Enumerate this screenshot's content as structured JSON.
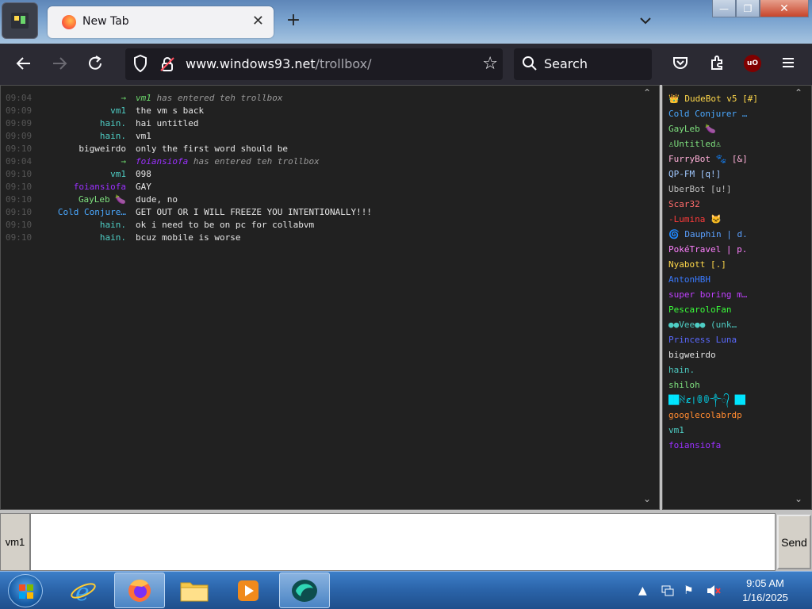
{
  "browser": {
    "tab_title": "New Tab",
    "tab_close": "✕",
    "new_tab": "+",
    "tab_list": "⌄",
    "url_host": "www.windows93.net",
    "url_path": "/trollbox/",
    "search_placeholder": "Search",
    "ublock_label": "uO",
    "window_min": "—",
    "window_max": "❐",
    "window_close": "✕"
  },
  "chat": {
    "messages": [
      {
        "time": "09:04",
        "nick": "→",
        "nick_color": "#6bd66b",
        "text_nick": "vm1",
        "text_nick_color": "#6bd66b",
        "text": "has entered teh trollbox",
        "system": true
      },
      {
        "time": "09:09",
        "nick": "vm1",
        "nick_color": "#4ecdc4",
        "text": "the vm s back",
        "system": false
      },
      {
        "time": "09:09",
        "nick": "hain.",
        "nick_color": "#4ecdc4",
        "text": "hai untitled",
        "system": false
      },
      {
        "time": "09:09",
        "nick": "hain.",
        "nick_color": "#4ecdc4",
        "text": "vm1",
        "system": false
      },
      {
        "time": "09:10",
        "nick": "bigweirdo",
        "nick_color": "#e6e6e6",
        "text": "only the first word should be",
        "system": false
      },
      {
        "time": "09:04",
        "nick": "→",
        "nick_color": "#6bd66b",
        "text_nick": "foiansiofa",
        "text_nick_color": "#9b30ff",
        "text": "has entered teh trollbox",
        "system": true
      },
      {
        "time": "09:10",
        "nick": "vm1",
        "nick_color": "#4ecdc4",
        "text": "098",
        "system": false
      },
      {
        "time": "09:10",
        "nick": "foiansiofa",
        "nick_color": "#9b30ff",
        "text": "GAY",
        "system": false
      },
      {
        "time": "09:10",
        "nick": "GayLeb 🍆",
        "nick_color": "#7ee07e",
        "text": "dude, no",
        "system": false
      },
      {
        "time": "09:10",
        "nick": "Cold Conjure…",
        "nick_color": "#4aa8ff",
        "text": "GET OUT OR I WILL FREEZE YOU INTENTIONALLY!!!",
        "system": false
      },
      {
        "time": "09:10",
        "nick": "hain.",
        "nick_color": "#4ecdc4",
        "text": "ok i need to be on pc for collabvm",
        "system": false
      },
      {
        "time": "09:10",
        "nick": "hain.",
        "nick_color": "#4ecdc4",
        "text": "bcuz mobile is worse",
        "system": false
      }
    ],
    "current_nick": "vm1",
    "send_label": "Send",
    "input_value": ""
  },
  "users": [
    {
      "name": "👑 DudeBot v5 [#]",
      "color": "#ffd84a"
    },
    {
      "name": "Cold Conjurer …",
      "color": "#4aa8ff"
    },
    {
      "name": "GayLeb 🍆",
      "color": "#7ee07e"
    },
    {
      "name": "♙Untitled♙",
      "color": "#7ee07e"
    },
    {
      "name": "FurryBot 🐾 [&]",
      "color": "#ffb0d8"
    },
    {
      "name": "QP-FM [q!]",
      "color": "#a0c8ff"
    },
    {
      "name": "UberBot [u!]",
      "color": "#bbbbbb"
    },
    {
      "name": "Scar32",
      "color": "#ff6b6b"
    },
    {
      "name": "-Lumina 🐱",
      "color": "#ff3b3b"
    },
    {
      "name": "🌀 Dauphin | d.",
      "color": "#5aa0ff"
    },
    {
      "name": "PokéTravel | p.",
      "color": "#ff80ff"
    },
    {
      "name": "Nyabott [.]",
      "color": "#ffd84a"
    },
    {
      "name": "AntonHBH",
      "color": "#3a7aff"
    },
    {
      "name": "super boring m…",
      "color": "#c040ff"
    },
    {
      "name": "PescaroloFan",
      "color": "#3aff3a"
    },
    {
      "name": "●●Vee●● (unk…",
      "color": "#4ecdc4"
    },
    {
      "name": "Princess Luna",
      "color": "#5a6aff"
    },
    {
      "name": "bigweirdo",
      "color": "#e6e6e6"
    },
    {
      "name": "hain.",
      "color": "#4ecdc4"
    },
    {
      "name": "shiloh",
      "color": "#7ee07e"
    },
    {
      "name": "██ꋊȼ❘ꂦꂦ༒᭄ ██",
      "color": "#00e5ff"
    },
    {
      "name": "googlecolabrdp",
      "color": "#ff8a30"
    },
    {
      "name": "vm1",
      "color": "#4ecdc4"
    },
    {
      "name": "foiansiofa",
      "color": "#9b30ff"
    }
  ],
  "taskbar": {
    "time": "9:05 AM",
    "date": "1/16/2025",
    "apps": [
      "internet-explorer",
      "firefox",
      "file-explorer",
      "media-player",
      "collabvm"
    ]
  }
}
